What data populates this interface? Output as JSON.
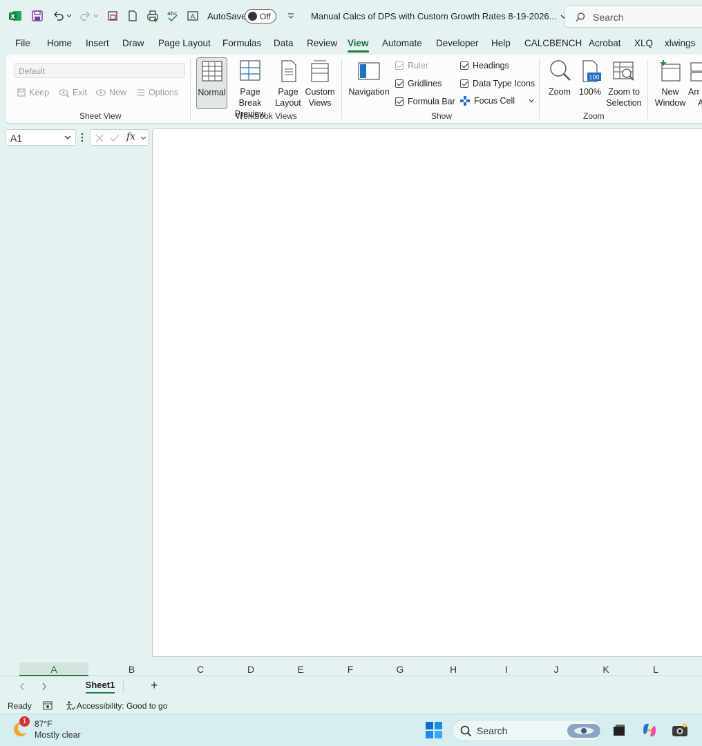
{
  "titlebar": {
    "autosave_label": "AutoSave",
    "autosave_state": "Off",
    "document_title": "Manual Calcs of DPS with Custom Growth Rates 8-19-2026...",
    "search_placeholder": "Search"
  },
  "menu": {
    "tabs": [
      "File",
      "Home",
      "Insert",
      "Draw",
      "Page Layout",
      "Formulas",
      "Data",
      "Review",
      "View",
      "Automate",
      "Developer",
      "Help",
      "CALCBENCH",
      "Acrobat",
      "XLQ",
      "xlwings"
    ],
    "active_tab": "View"
  },
  "ribbon": {
    "sheet_view": {
      "dropdown_value": "Default",
      "keep": "Keep",
      "exit": "Exit",
      "new": "New",
      "options": "Options",
      "label": "Sheet View"
    },
    "workbook_views": {
      "normal": "Normal",
      "page_break_line1": "Page Break",
      "page_break_line2": "Preview",
      "page_layout_line1": "Page",
      "page_layout_line2": "Layout",
      "custom_views_line1": "Custom",
      "custom_views_line2": "Views",
      "label": "Workbook Views"
    },
    "show": {
      "navigation": "Navigation",
      "ruler": "Ruler",
      "gridlines": "Gridlines",
      "formula_bar": "Formula Bar",
      "headings": "Headings",
      "data_type_icons": "Data Type Icons",
      "focus_cell": "Focus Cell",
      "label": "Show"
    },
    "zoom": {
      "zoom": "Zoom",
      "hundred": "100%",
      "hundred_badge": "100",
      "zoom_to_sel_line1": "Zoom to",
      "zoom_to_sel_line2": "Selection",
      "label": "Zoom"
    },
    "window": {
      "new_window_line1": "New",
      "new_window_line2": "Window",
      "arrange_line1": "Arr",
      "arrange_line2": "A"
    }
  },
  "formula_bar": {
    "name_box": "A1",
    "fx": "fx"
  },
  "columns": [
    "A",
    "B",
    "C",
    "D",
    "E",
    "F",
    "G",
    "H",
    "I",
    "J",
    "K",
    "L"
  ],
  "sheets": {
    "active": "Sheet1",
    "add": "+"
  },
  "status": {
    "ready": "Ready",
    "accessibility": "Accessibility: Good to go"
  },
  "taskbar": {
    "weather_temp": "87°F",
    "weather_desc": "Mostly clear",
    "weather_badge": "1",
    "search": "Search"
  },
  "colors": {
    "accent_green": "#1a7d43",
    "background": "#e6f2f2",
    "taskbar": "#d7eef1"
  }
}
